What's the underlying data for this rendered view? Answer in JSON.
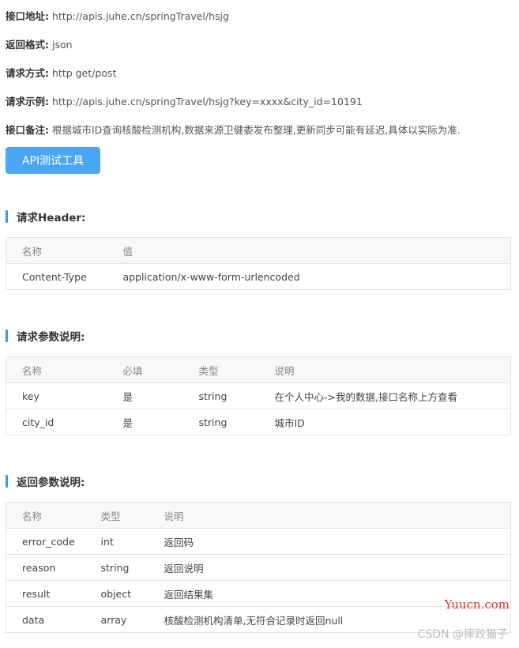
{
  "info": [
    {
      "key": "接口地址:",
      "value": "http://apis.juhe.cn/springTravel/hsjg"
    },
    {
      "key": "返回格式:",
      "value": "json"
    },
    {
      "key": "请求方式:",
      "value": "http get/post"
    },
    {
      "key": "请求示例:",
      "value": "http://apis.juhe.cn/springTravel/hsjg?key=xxxx&city_id=10191"
    },
    {
      "key": "接口备注:",
      "value": "根据城市ID查询核酸检测机构,数据来源卫健委发布整理,更新同步可能有延迟,具体以实际为准."
    }
  ],
  "test_button": "API测试工具",
  "header_section": {
    "title": "请求Header:",
    "columns": [
      "名称",
      "值"
    ],
    "rows": [
      [
        "Content-Type",
        "application/x-www-form-urlencoded"
      ]
    ]
  },
  "params_section": {
    "title": "请求参数说明:",
    "columns": [
      "名称",
      "必填",
      "类型",
      "说明"
    ],
    "rows": [
      [
        "key",
        "是",
        "string",
        "在个人中心->我的数据,接口名称上方查看"
      ],
      [
        "city_id",
        "是",
        "string",
        "城市ID"
      ]
    ]
  },
  "return_section": {
    "title": "返回参数说明:",
    "columns": [
      "名称",
      "类型",
      "说明"
    ],
    "rows": [
      [
        "error_code",
        "int",
        "返回码"
      ],
      [
        "reason",
        "string",
        "返回说明"
      ],
      [
        "result",
        "object",
        "返回结果集"
      ],
      [
        "data",
        "array",
        "核酸检测机构清单,无符合记录时返回null"
      ]
    ]
  },
  "watermark_site": "Yuucn.com",
  "watermark_csdn": "CSDN @摔跤猫子",
  "colors": {
    "accent": "#3a9bec",
    "button": "#4aa5f3",
    "watermark_red": "#d33"
  }
}
